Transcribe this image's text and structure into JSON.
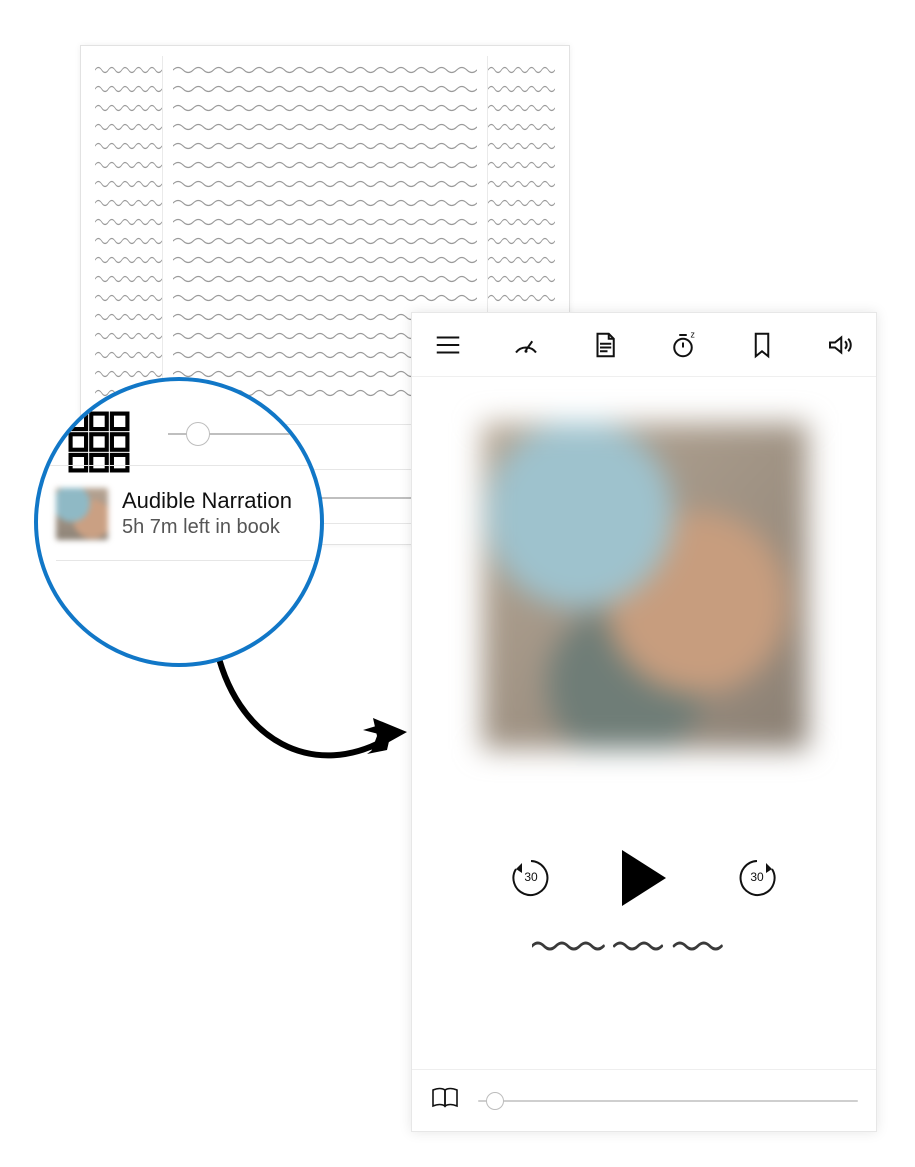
{
  "callout": {
    "title": "Audible Narration",
    "subtitle": "5h 7m left in book",
    "grid_icon": "grid-icon",
    "thumb_icon": "book-cover-thumb"
  },
  "reader": {
    "slider_value": 6,
    "grid_icon": "grid-icon"
  },
  "player": {
    "toolbar": {
      "menu": "menu-icon",
      "speed": "speed-gauge-icon",
      "chapters": "document-icon",
      "sleep": "sleep-timer-icon",
      "bookmark": "bookmark-icon",
      "volume": "volume-icon"
    },
    "skip_back_seconds": "30",
    "skip_fwd_seconds": "30",
    "play_label": "Play",
    "progress_value": 2,
    "book_icon": "open-book-icon"
  },
  "colors": {
    "accent": "#1177c7"
  }
}
